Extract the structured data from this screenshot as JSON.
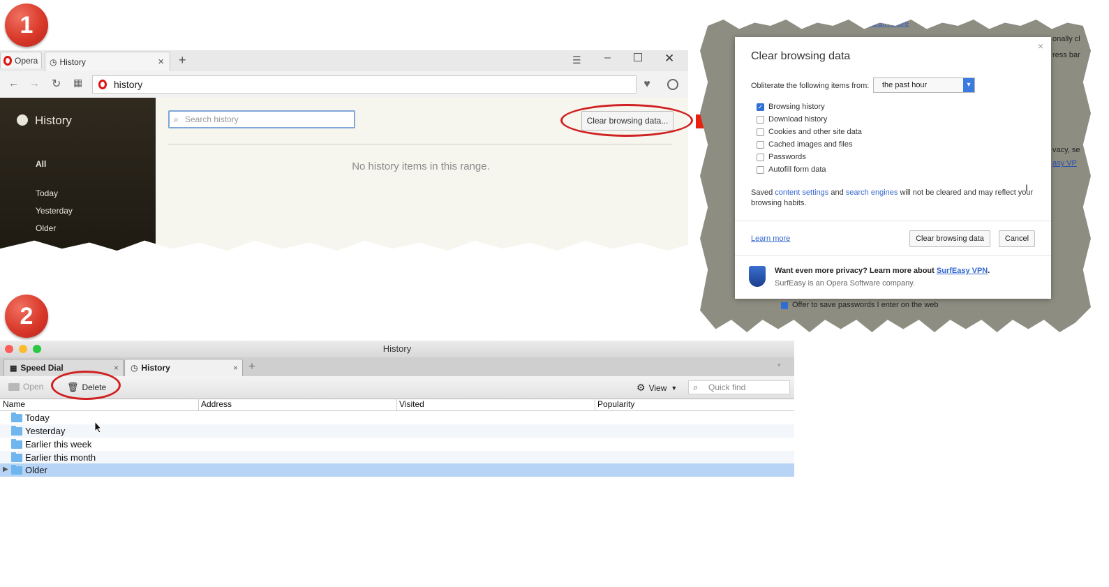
{
  "badges": {
    "one": "1",
    "two": "2"
  },
  "opera": {
    "logo_tab": "Opera",
    "tab_title": "History",
    "tab_close": "×",
    "new_tab": "+",
    "address": "history",
    "sidebar_title": "History",
    "sidebar_items": [
      "All",
      "Today",
      "Yesterday",
      "Older"
    ],
    "search_placeholder": "Search history",
    "clear_button": "Clear browsing data...",
    "empty_message": "No history items in this range."
  },
  "dialog": {
    "title": "Clear browsing data",
    "close": "×",
    "obliterate_label": "Obliterate the following items from:",
    "period_value": "the past hour",
    "checkboxes": [
      {
        "label": "Browsing history",
        "checked": true
      },
      {
        "label": "Download history",
        "checked": false
      },
      {
        "label": "Cookies and other site data",
        "checked": false
      },
      {
        "label": "Cached images and files",
        "checked": false
      },
      {
        "label": "Passwords",
        "checked": false
      },
      {
        "label": "Autofill form data",
        "checked": false
      }
    ],
    "note_prefix": "Saved ",
    "note_link1": "content settings",
    "note_mid": " and ",
    "note_link2": "search engines",
    "note_suffix": " will not be cleared and may reflect your browsing habits.",
    "learn_more": "Learn more",
    "clear_button": "Clear browsing data",
    "cancel_button": "Cancel",
    "promo_bold": "Want even more privacy? Learn more about ",
    "promo_link": "SurfEasy VPN",
    "promo_period": ".",
    "promo_sub": "SurfEasy is an Opera Software company.",
    "bg_fragment_learn": "Learn more",
    "bg_fragment_1": "onally cl",
    "bg_fragment_2": "ress bar",
    "bg_fragment_3": "vacy, se",
    "bg_fragment_4": "asy VP",
    "bg_offer": "Offer to save passwords I enter on the web"
  },
  "mac": {
    "window_title": "History",
    "tabs": [
      {
        "label": "Speed Dial",
        "close": "×"
      },
      {
        "label": "History",
        "close": "×"
      }
    ],
    "new_tab": "+",
    "toolbar": {
      "open": "Open",
      "delete": "Delete",
      "view": "View",
      "quick_find": "Quick find"
    },
    "columns": [
      "Name",
      "Address",
      "Visited",
      "Popularity"
    ],
    "rows": [
      "Today",
      "Yesterday",
      "Earlier this week",
      "Earlier this month",
      "Older"
    ],
    "selected_row": "Older"
  },
  "colors": {
    "accent_red": "#d02020",
    "selection": "#b7d4f7",
    "link": "#3366cc"
  }
}
